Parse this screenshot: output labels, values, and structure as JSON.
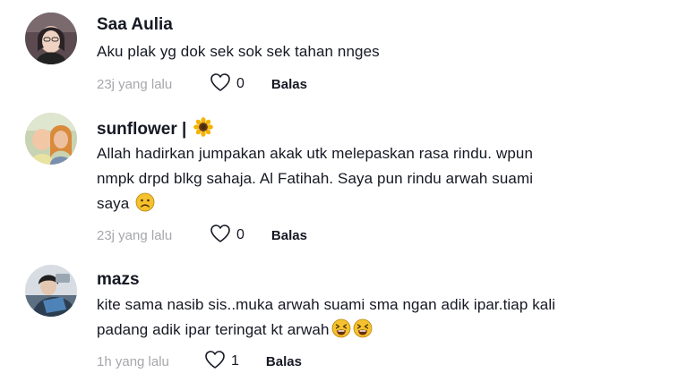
{
  "comments": [
    {
      "username": "Saa Aulia",
      "text_lines": [
        "Aku plak yg dok sek sok sek tahan nnges"
      ],
      "time": "23j yang lalu",
      "likes": "0",
      "reply_label": "Balas"
    },
    {
      "username": "sunflower |",
      "username_emoji": "sunflower-icon",
      "text_lines": [
        "Allah hadirkan jumpakan akak utk melepaskan rasa rindu. wpun",
        "nmpk drpd blkg sahaja. Al Fatihah. Saya pun rindu arwah suami",
        "saya"
      ],
      "text_emoji": "sad-face-emoji",
      "time": "23j yang lalu",
      "likes": "0",
      "reply_label": "Balas"
    },
    {
      "username": "mazs",
      "text_lines": [
        "kite sama nasib sis..muka arwah suami sma ngan adik ipar.tiap kali",
        "padang adik ipar teringat kt arwah"
      ],
      "text_emojis": [
        "tired-face-emoji",
        "tired-face-emoji"
      ],
      "time": "1h yang lalu",
      "likes": "1",
      "reply_label": "Balas"
    }
  ],
  "icons": {
    "like": "heart-outline-icon"
  },
  "colors": {
    "text": "#161823",
    "muted": "#a6a7ab",
    "emoji_yellow": "#f5c12e"
  }
}
